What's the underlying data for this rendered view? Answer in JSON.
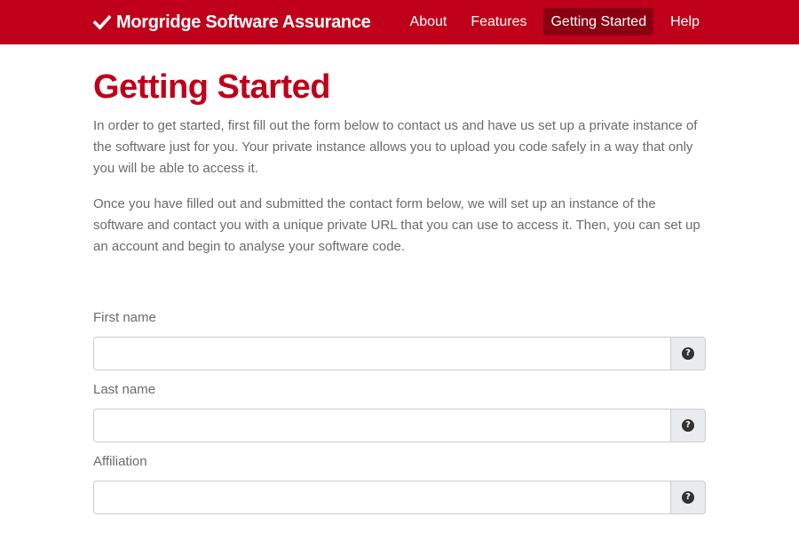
{
  "navbar": {
    "brand": "Morgridge Software Assurance",
    "brand_icon": "check-icon",
    "background": "#c0001a",
    "active_background": "#8a0012",
    "items": [
      {
        "label": "About",
        "active": false
      },
      {
        "label": "Features",
        "active": false
      },
      {
        "label": "Getting Started",
        "active": true
      },
      {
        "label": "Help",
        "active": false
      }
    ]
  },
  "main": {
    "title": "Getting Started",
    "title_color": "#c0001a",
    "paragraphs": [
      "In order to get started, first fill out the form below to contact us and have us set up a private instance of the software just for you. Your private instance allows you to upload you code safely in a way that only you will be able to access it.",
      "Once you have filled out and submitted the contact form below, we will set up an instance of the software and contact you with a unique private URL that you can use to access it. Then, you can set up an account and begin to analyse your software code."
    ]
  },
  "form": {
    "fields": [
      {
        "label": "First name",
        "value": "",
        "placeholder": "",
        "help_icon": "question-circle-icon"
      },
      {
        "label": "Last name",
        "value": "",
        "placeholder": "",
        "help_icon": "question-circle-icon"
      },
      {
        "label": "Affiliation",
        "value": "",
        "placeholder": "",
        "help_icon": "question-circle-icon"
      }
    ]
  }
}
